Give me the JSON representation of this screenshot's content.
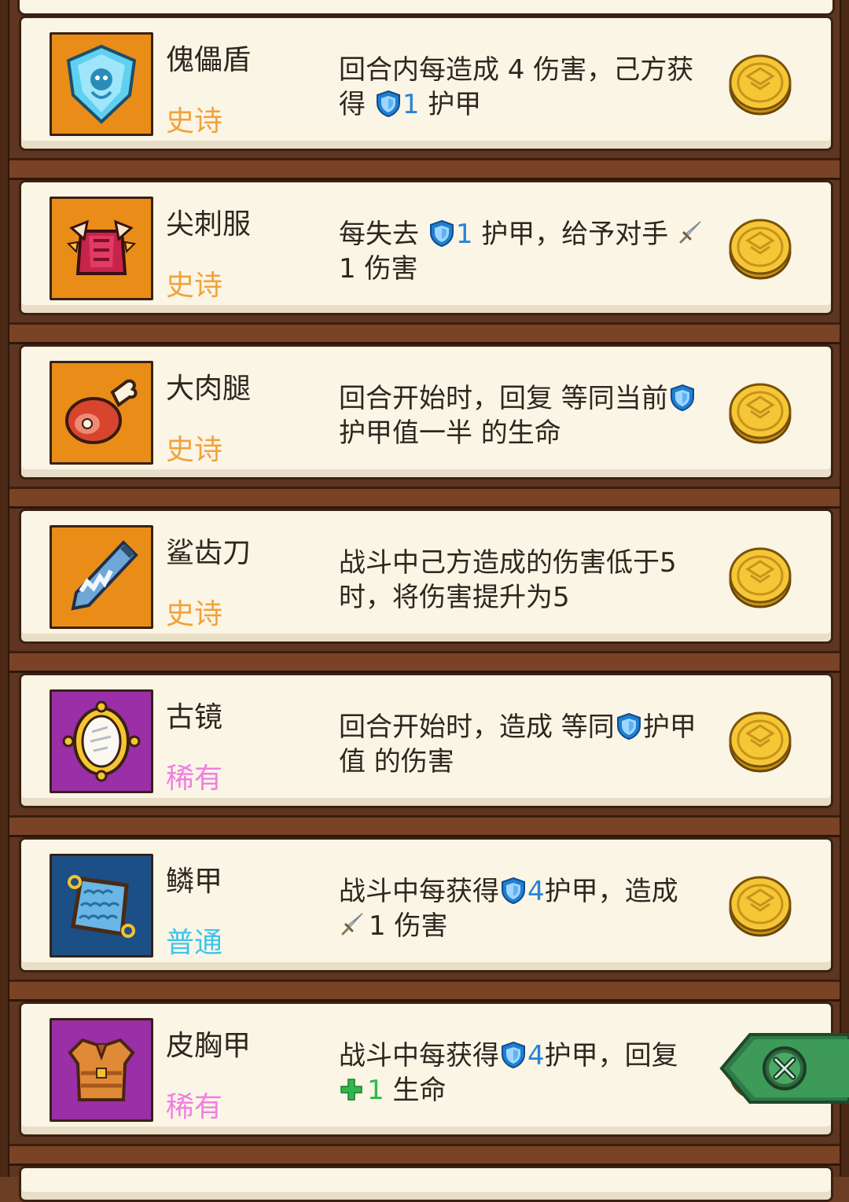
{
  "items": [
    {
      "name": "傀儡盾",
      "rarity": "史诗",
      "rarity_color": "#f2a23a",
      "box_color": "#e98d18",
      "desc_parts": [
        {
          "t": "text",
          "v": "回合内每造成 4 伤害，己方获得 "
        },
        {
          "t": "shield"
        },
        {
          "t": "num",
          "v": "1"
        },
        {
          "t": "text",
          "v": " 护甲"
        }
      ],
      "icon": "puppet-shield-icon"
    },
    {
      "name": "尖刺服",
      "rarity": "史诗",
      "rarity_color": "#f2a23a",
      "box_color": "#e98d18",
      "desc_parts": [
        {
          "t": "text",
          "v": "每失去 "
        },
        {
          "t": "shield"
        },
        {
          "t": "num",
          "v": "1"
        },
        {
          "t": "text",
          "v": " 护甲，给予对手 "
        },
        {
          "t": "sword"
        },
        {
          "t": "text",
          "v": "1 伤害"
        }
      ],
      "icon": "spiked-armor-icon"
    },
    {
      "name": "大肉腿",
      "rarity": "史诗",
      "rarity_color": "#f2a23a",
      "box_color": "#e98d18",
      "desc_parts": [
        {
          "t": "text",
          "v": "回合开始时，回复 等同当前"
        },
        {
          "t": "shield"
        },
        {
          "t": "text",
          "v": "护甲值一半 的生命"
        }
      ],
      "icon": "meat-leg-icon"
    },
    {
      "name": "鲨齿刀",
      "rarity": "史诗",
      "rarity_color": "#f2a23a",
      "box_color": "#e98d18",
      "desc_parts": [
        {
          "t": "text",
          "v": "战斗中己方造成的伤害低于5时，将伤害提升为5"
        }
      ],
      "icon": "shark-blade-icon"
    },
    {
      "name": "古镜",
      "rarity": "稀有",
      "rarity_color": "#f07fe0",
      "box_color": "#9a2fa8",
      "desc_parts": [
        {
          "t": "text",
          "v": "回合开始时，造成 等同"
        },
        {
          "t": "shield"
        },
        {
          "t": "text",
          "v": "护甲值 的伤害"
        }
      ],
      "icon": "ancient-mirror-icon"
    },
    {
      "name": "鳞甲",
      "rarity": "普通",
      "rarity_color": "#3fc5e8",
      "box_color": "#1b4f86",
      "desc_parts": [
        {
          "t": "text",
          "v": "战斗中每获得"
        },
        {
          "t": "shield"
        },
        {
          "t": "num",
          "v": "4"
        },
        {
          "t": "text",
          "v": "护甲，造成 "
        },
        {
          "t": "sword"
        },
        {
          "t": "text",
          "v": "1 伤害"
        }
      ],
      "icon": "scale-armor-icon"
    },
    {
      "name": "皮胸甲",
      "rarity": "稀有",
      "rarity_color": "#f07fe0",
      "box_color": "#9a2fa8",
      "desc_parts": [
        {
          "t": "text",
          "v": "战斗中每获得"
        },
        {
          "t": "shield"
        },
        {
          "t": "num",
          "v": "4"
        },
        {
          "t": "text",
          "v": "护甲，回复 "
        },
        {
          "t": "plus"
        },
        {
          "t": "numg",
          "v": "1"
        },
        {
          "t": "text",
          "v": " 生命"
        }
      ],
      "icon": "leather-chestplate-icon"
    }
  ],
  "close_button": {
    "icon": "close-icon",
    "color": "#3d8f55"
  },
  "coin_icon": "gold-coin-icon"
}
